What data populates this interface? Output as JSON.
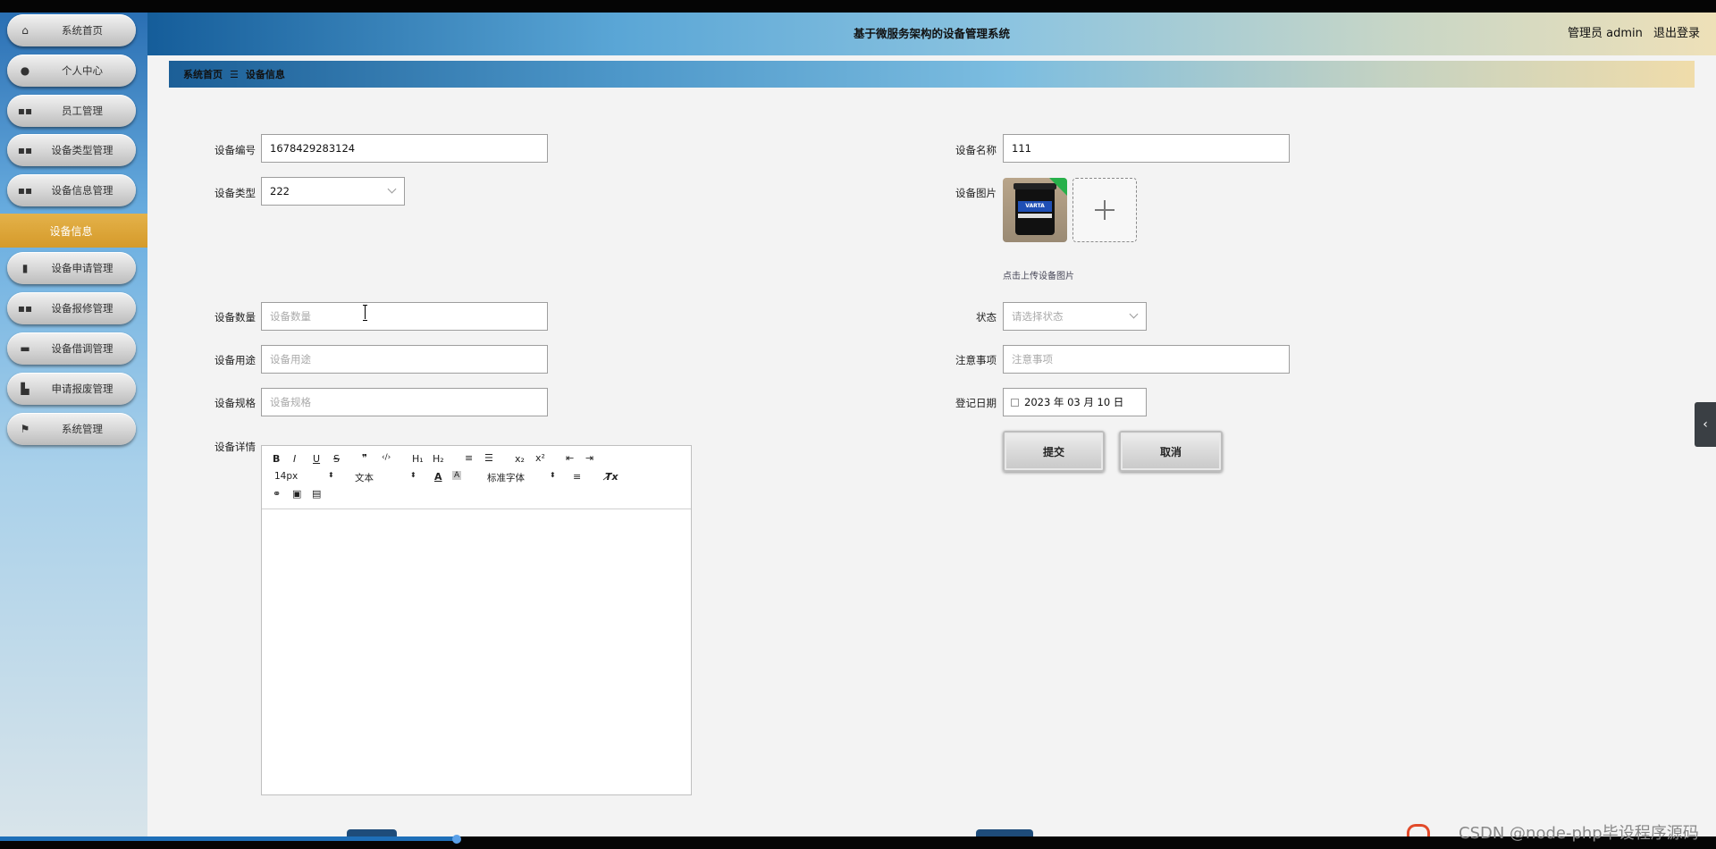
{
  "app": {
    "title": "基于微服务架构的设备管理系统"
  },
  "header": {
    "user_label": "管理员 admin",
    "logout_label": "退出登录"
  },
  "sidebar": {
    "items": [
      {
        "label": "系统首页",
        "icon": "home-icon"
      },
      {
        "label": "个人中心",
        "icon": "user-icon"
      },
      {
        "label": "员工管理",
        "icon": "grid-icon"
      },
      {
        "label": "设备类型管理",
        "icon": "grid-icon"
      },
      {
        "label": "设备信息管理",
        "icon": "grid-icon"
      },
      {
        "label": "设备申请管理",
        "icon": "clipboard-icon"
      },
      {
        "label": "设备报修管理",
        "icon": "grid-icon"
      },
      {
        "label": "设备借调管理",
        "icon": "briefcase-icon"
      },
      {
        "label": "申请报废管理",
        "icon": "truck-icon"
      },
      {
        "label": "系统管理",
        "icon": "flag-icon"
      }
    ],
    "active_submenu": "设备信息"
  },
  "breadcrumb": {
    "home": "系统首页",
    "separator": "☰",
    "current": "设备信息"
  },
  "form": {
    "device_no": {
      "label": "设备编号",
      "value": "1678429283124"
    },
    "device_name": {
      "label": "设备名称",
      "value": "111"
    },
    "device_type": {
      "label": "设备类型",
      "value": "222"
    },
    "device_image": {
      "label": "设备图片",
      "hint": "点击上传设备图片",
      "thumb_text": "VARTA"
    },
    "quantity": {
      "label": "设备数量",
      "placeholder": "设备数量"
    },
    "status": {
      "label": "状态",
      "placeholder": "请选择状态"
    },
    "usage": {
      "label": "设备用途",
      "placeholder": "设备用途"
    },
    "notes": {
      "label": "注意事项",
      "placeholder": "注意事项"
    },
    "spec": {
      "label": "设备规格",
      "placeholder": "设备规格"
    },
    "register_date": {
      "label": "登记日期",
      "value": "2023 年 03 月 10 日"
    },
    "details": {
      "label": "设备详情"
    }
  },
  "editor": {
    "font_size": "14px",
    "text_style": "文本",
    "font_family": "标准字体",
    "buttons": {
      "bold": "B",
      "italic": "I",
      "underline": "U",
      "strike": "S",
      "quote": "❞",
      "code": "‹/›",
      "h1": "H₁",
      "h2": "H₂",
      "ordered_list": "≡",
      "bullet_list": "☰",
      "subscript": "x₂",
      "superscript": "x²",
      "outdent": "⇤",
      "indent": "⇥",
      "font_color": "A",
      "bg_color": "A",
      "align": "≡",
      "clear": "T̸x",
      "link": "⚭",
      "image": "▣",
      "video": "▤"
    }
  },
  "actions": {
    "submit": "提交",
    "cancel": "取消"
  },
  "watermark": "CSDN @node-php毕设程序源码",
  "colors": {
    "accent": "#d59a2a",
    "header_start": "#155d9a",
    "header_end": "#eee0b8"
  }
}
